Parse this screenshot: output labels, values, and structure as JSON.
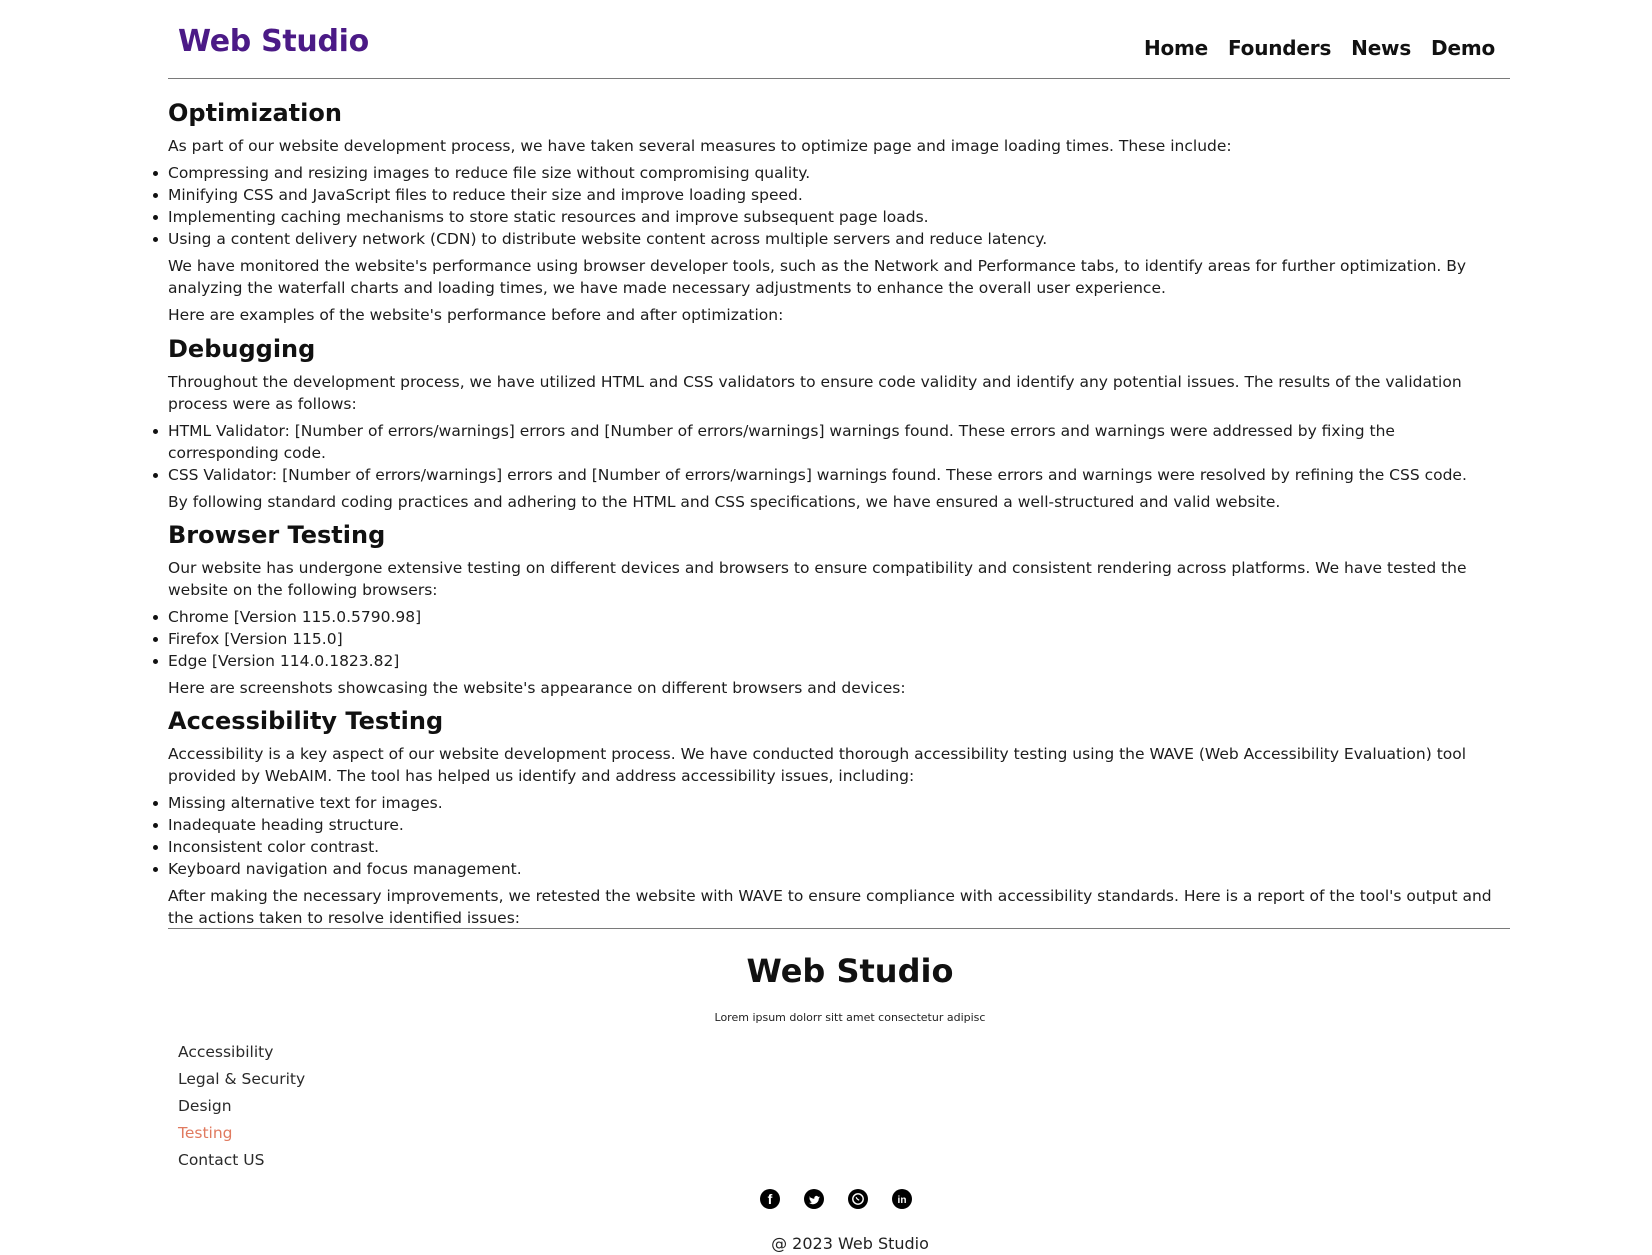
{
  "header": {
    "logo": "Web Studio",
    "nav": [
      "Home",
      "Founders",
      "News",
      "Demo"
    ]
  },
  "optimization": {
    "heading": "Optimization",
    "intro": "As part of our website development process, we have taken several measures to optimize page and image loading times. These include:",
    "items": [
      "Compressing and resizing images to reduce file size without compromising quality.",
      "Minifying CSS and JavaScript files to reduce their size and improve loading speed.",
      "Implementing caching mechanisms to store static resources and improve subsequent page loads.",
      "Using a content delivery network (CDN) to distribute website content across multiple servers and reduce latency."
    ],
    "para": "We have monitored the website's performance using browser developer tools, such as the Network and Performance tabs, to identify areas for further optimization. By analyzing the waterfall charts and loading times, we have made necessary adjustments to enhance the overall user experience.",
    "examples": "Here are examples of the website's performance before and after optimization:"
  },
  "debugging": {
    "heading": "Debugging",
    "intro": "Throughout the development process, we have utilized HTML and CSS validators to ensure code validity and identify any potential issues. The results of the validation process were as follows:",
    "items": [
      "HTML Validator: [Number of errors/warnings] errors and [Number of errors/warnings] warnings found. These errors and warnings were addressed by fixing the corresponding code.",
      "CSS Validator: [Number of errors/warnings] errors and [Number of errors/warnings] warnings found. These errors and warnings were resolved by refining the CSS code."
    ],
    "para": "By following standard coding practices and adhering to the HTML and CSS specifications, we have ensured a well-structured and valid website."
  },
  "browser": {
    "heading": "Browser Testing",
    "intro": "Our website has undergone extensive testing on different devices and browsers to ensure compatibility and consistent rendering across platforms. We have tested the website on the following browsers:",
    "items": [
      "Chrome [Version 115.0.5790.98]",
      "Firefox [Version 115.0]",
      "Edge [Version 114.0.1823.82]"
    ],
    "para": "Here are screenshots showcasing the website's appearance on different browsers and devices:"
  },
  "accessibility": {
    "heading": "Accessibility Testing",
    "intro": "Accessibility is a key aspect of our website development process. We have conducted thorough accessibility testing using the WAVE (Web Accessibility Evaluation) tool provided by WebAIM. The tool has helped us identify and address accessibility issues, including:",
    "items": [
      "Missing alternative text for images.",
      "Inadequate heading structure.",
      "Inconsistent color contrast.",
      "Keyboard navigation and focus management."
    ],
    "para": "After making the necessary improvements, we retested the website with WAVE to ensure compliance with accessibility standards. Here is a report of the tool's output and the actions taken to resolve identified issues:"
  },
  "footer": {
    "title": "Web Studio",
    "subtitle": "Lorem ipsum dolorr sitt amet consectetur adipisc",
    "links": [
      "Accessibility",
      "Legal & Security",
      "Design",
      "Testing",
      "Contact US"
    ],
    "active_link": "Testing",
    "social_icons": [
      "facebook-icon",
      "twitter-icon",
      "whatsapp-icon",
      "linkedin-icon"
    ],
    "copyright": "@ 2023 Web Studio",
    "accent_color": "#e07a5f"
  },
  "colors": {
    "logo": "#4b1a86",
    "text": "#1c1c1c",
    "rule": "#7a7a7a"
  }
}
